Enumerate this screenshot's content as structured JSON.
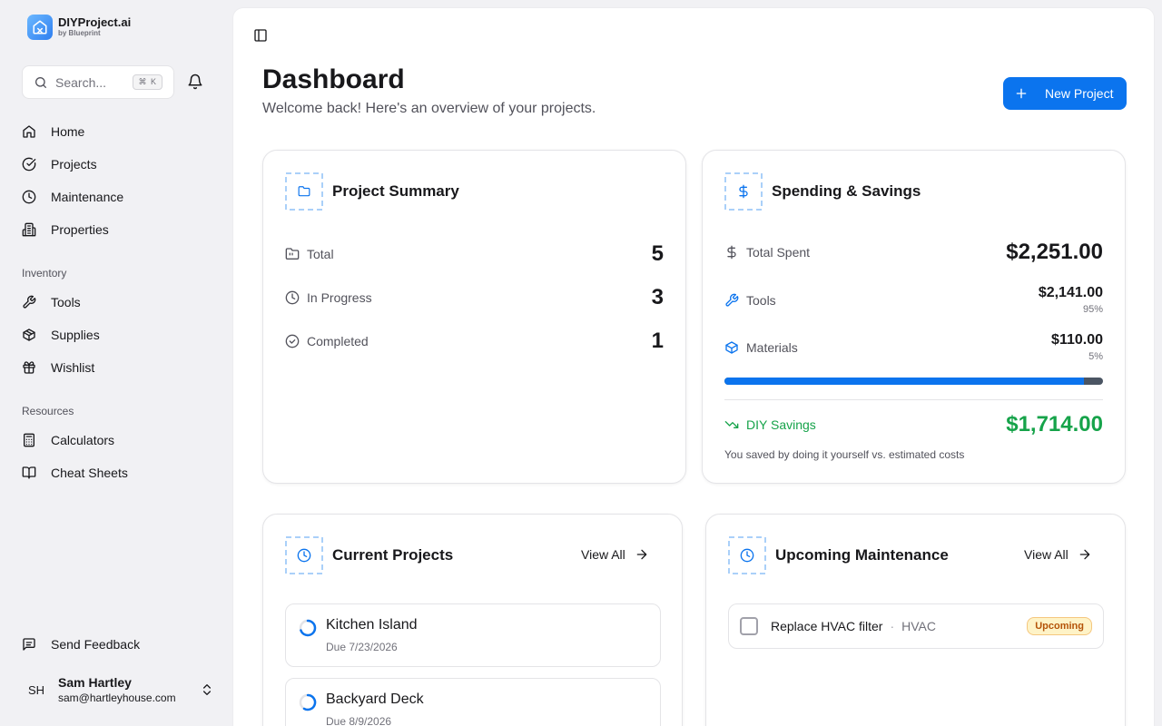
{
  "brand": {
    "name": "DIYProject.ai",
    "sub": "by Blueprint"
  },
  "search": {
    "placeholder": "Search...",
    "shortcut": "⌘ K"
  },
  "nav": {
    "home": "Home",
    "projects": "Projects",
    "maintenance": "Maintenance",
    "properties": "Properties",
    "inventory_label": "Inventory",
    "tools": "Tools",
    "supplies": "Supplies",
    "wishlist": "Wishlist",
    "resources_label": "Resources",
    "calculators": "Calculators",
    "cheat_sheets": "Cheat Sheets",
    "feedback": "Send Feedback"
  },
  "user": {
    "initials": "SH",
    "name": "Sam Hartley",
    "email": "sam@hartleyhouse.com"
  },
  "header": {
    "title": "Dashboard",
    "subtitle": "Welcome back! Here's an overview of your projects.",
    "new_project": "New Project"
  },
  "summary": {
    "title": "Project Summary",
    "total_label": "Total",
    "total_value": "5",
    "progress_label": "In Progress",
    "progress_value": "3",
    "completed_label": "Completed",
    "completed_value": "1"
  },
  "spending": {
    "title": "Spending & Savings",
    "total_label": "Total Spent",
    "total_value": "$2,251.00",
    "tools_label": "Tools",
    "tools_value": "$2,141.00",
    "tools_pct": "95%",
    "materials_label": "Materials",
    "materials_value": "$110.00",
    "materials_pct": "5%",
    "tools_share": 0.95,
    "savings_label": "DIY Savings",
    "savings_value": "$1,714.00",
    "savings_note": "You saved by doing it yourself vs. estimated costs"
  },
  "current": {
    "title": "Current Projects",
    "view_all": "View All",
    "items": [
      {
        "name": "Kitchen Island",
        "due": "Due 7/23/2026"
      },
      {
        "name": "Backyard Deck",
        "due": "Due 8/9/2026"
      }
    ]
  },
  "maintenance": {
    "title": "Upcoming Maintenance",
    "view_all": "View All",
    "items": [
      {
        "name": "Replace HVAC filter",
        "category": "HVAC",
        "status": "Upcoming"
      }
    ]
  },
  "colors": {
    "accent": "#0b74ee",
    "savings": "#16a34a",
    "badge": "#b45309"
  }
}
